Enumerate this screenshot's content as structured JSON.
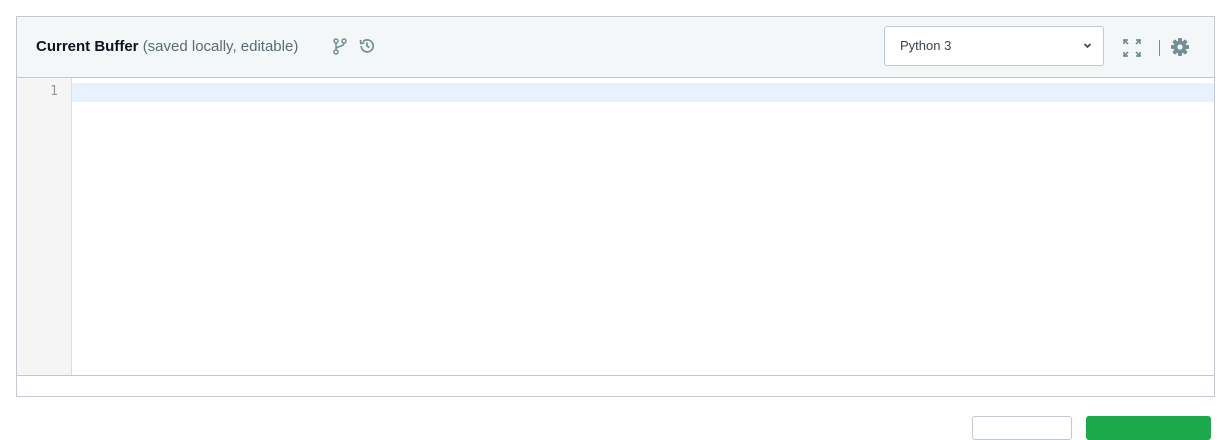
{
  "editor": {
    "title": "Current Buffer",
    "subtitle": "(saved locally, editable)",
    "icons": {
      "branch": "code-branch-icon",
      "history": "history-icon",
      "fullscreen": "expand-icon",
      "settings": "gear-icon"
    },
    "language": {
      "selected": "Python 3"
    },
    "line_numbers": [
      "1"
    ],
    "code": ""
  },
  "colors": {
    "header_bg": "#f3f7f7",
    "border": "#c2c7d0",
    "active_line": "#e8f2ff",
    "gutter_bg": "#f5f5f5",
    "submit_green": "#1ba94c"
  }
}
